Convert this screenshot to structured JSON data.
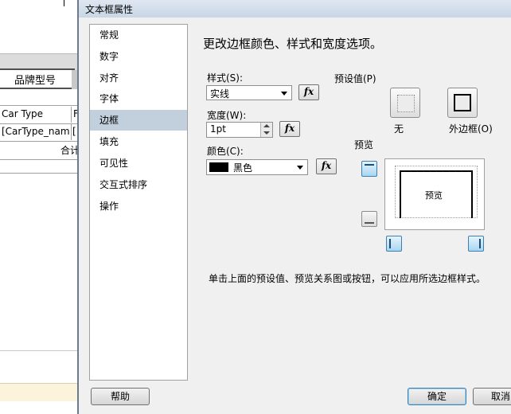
{
  "background": {
    "header_cell": "品牌型号",
    "col_header": "Car Type",
    "col_header_partial": "F",
    "field_cell": "[CarType_nam",
    "field_cell_partial": "[",
    "total_label": "合计"
  },
  "dialog": {
    "title": "文本框属性",
    "nav": [
      "常规",
      "数字",
      "对齐",
      "字体",
      "边框",
      "填充",
      "可见性",
      "交互式排序",
      "操作"
    ],
    "heading": "更改边框颜色、样式和宽度选项。",
    "style": {
      "label": "样式(S):",
      "value": "实线"
    },
    "width": {
      "label": "宽度(W):",
      "value": "1pt"
    },
    "color": {
      "label": "颜色(C):",
      "value": "黑色",
      "swatch": "#000000"
    },
    "fx_label": "fx",
    "presets": {
      "label": "预设值(P)",
      "none": "无",
      "outline": "外边框(O)"
    },
    "preview": {
      "label": "预览",
      "center_text": "预览"
    },
    "hint": "单击上面的预设值、预览关系图或按钮，可以应用所选边框样式。",
    "buttons": {
      "help": "帮助",
      "ok": "确定",
      "cancel": "取消"
    }
  },
  "colors": {
    "accent": "#3c7fb1",
    "nav_selected": "#c2d0de",
    "dialog_bg": "#f0f0f0"
  }
}
